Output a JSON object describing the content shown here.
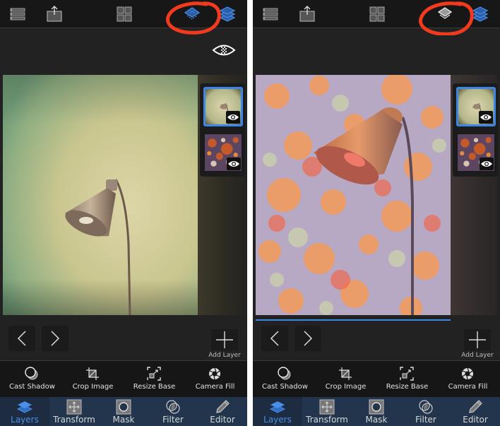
{
  "colors": {
    "accent": "#3d86e6",
    "annotation": "#f23a1f",
    "topbar_bg": "#171717",
    "tabbar_bg": "#23354d"
  },
  "topbar": {
    "icons": [
      "menu-list-icon",
      "share-export-icon",
      "grid-icon",
      "layer-mode-icon",
      "layers-stack-icon"
    ]
  },
  "screens": [
    {
      "label": "before",
      "layer_mode_icon_state": "blue-dotted",
      "visibility_icon_shown": true,
      "progress_line_shown": false,
      "photo": "green vintage wall with desk lamp"
    },
    {
      "label": "after",
      "layer_mode_icon_state": "white-outline",
      "visibility_icon_shown": false,
      "progress_line_shown": true,
      "photo": "lamp blended with orange/purple rust texture"
    }
  ],
  "layers": [
    {
      "name": "Lamp photo",
      "selected": true,
      "visible": true
    },
    {
      "name": "Rust texture",
      "selected": false,
      "visible": true
    }
  ],
  "add_layer_label": "Add Layer",
  "toolbar": [
    {
      "label": "Cast Shadow",
      "icon": "cast-shadow-icon"
    },
    {
      "label": "Crop Image",
      "icon": "crop-icon"
    },
    {
      "label": "Resize Base",
      "icon": "resize-icon"
    },
    {
      "label": "Camera Fill",
      "icon": "aperture-icon"
    }
  ],
  "tabs": [
    {
      "label": "Layers",
      "icon": "layers-icon",
      "active": true
    },
    {
      "label": "Transform",
      "icon": "transform-icon",
      "active": false
    },
    {
      "label": "Mask",
      "icon": "mask-icon",
      "active": false
    },
    {
      "label": "Filter",
      "icon": "filter-icon",
      "active": false
    },
    {
      "label": "Editor",
      "icon": "pencil-icon",
      "active": false
    }
  ]
}
